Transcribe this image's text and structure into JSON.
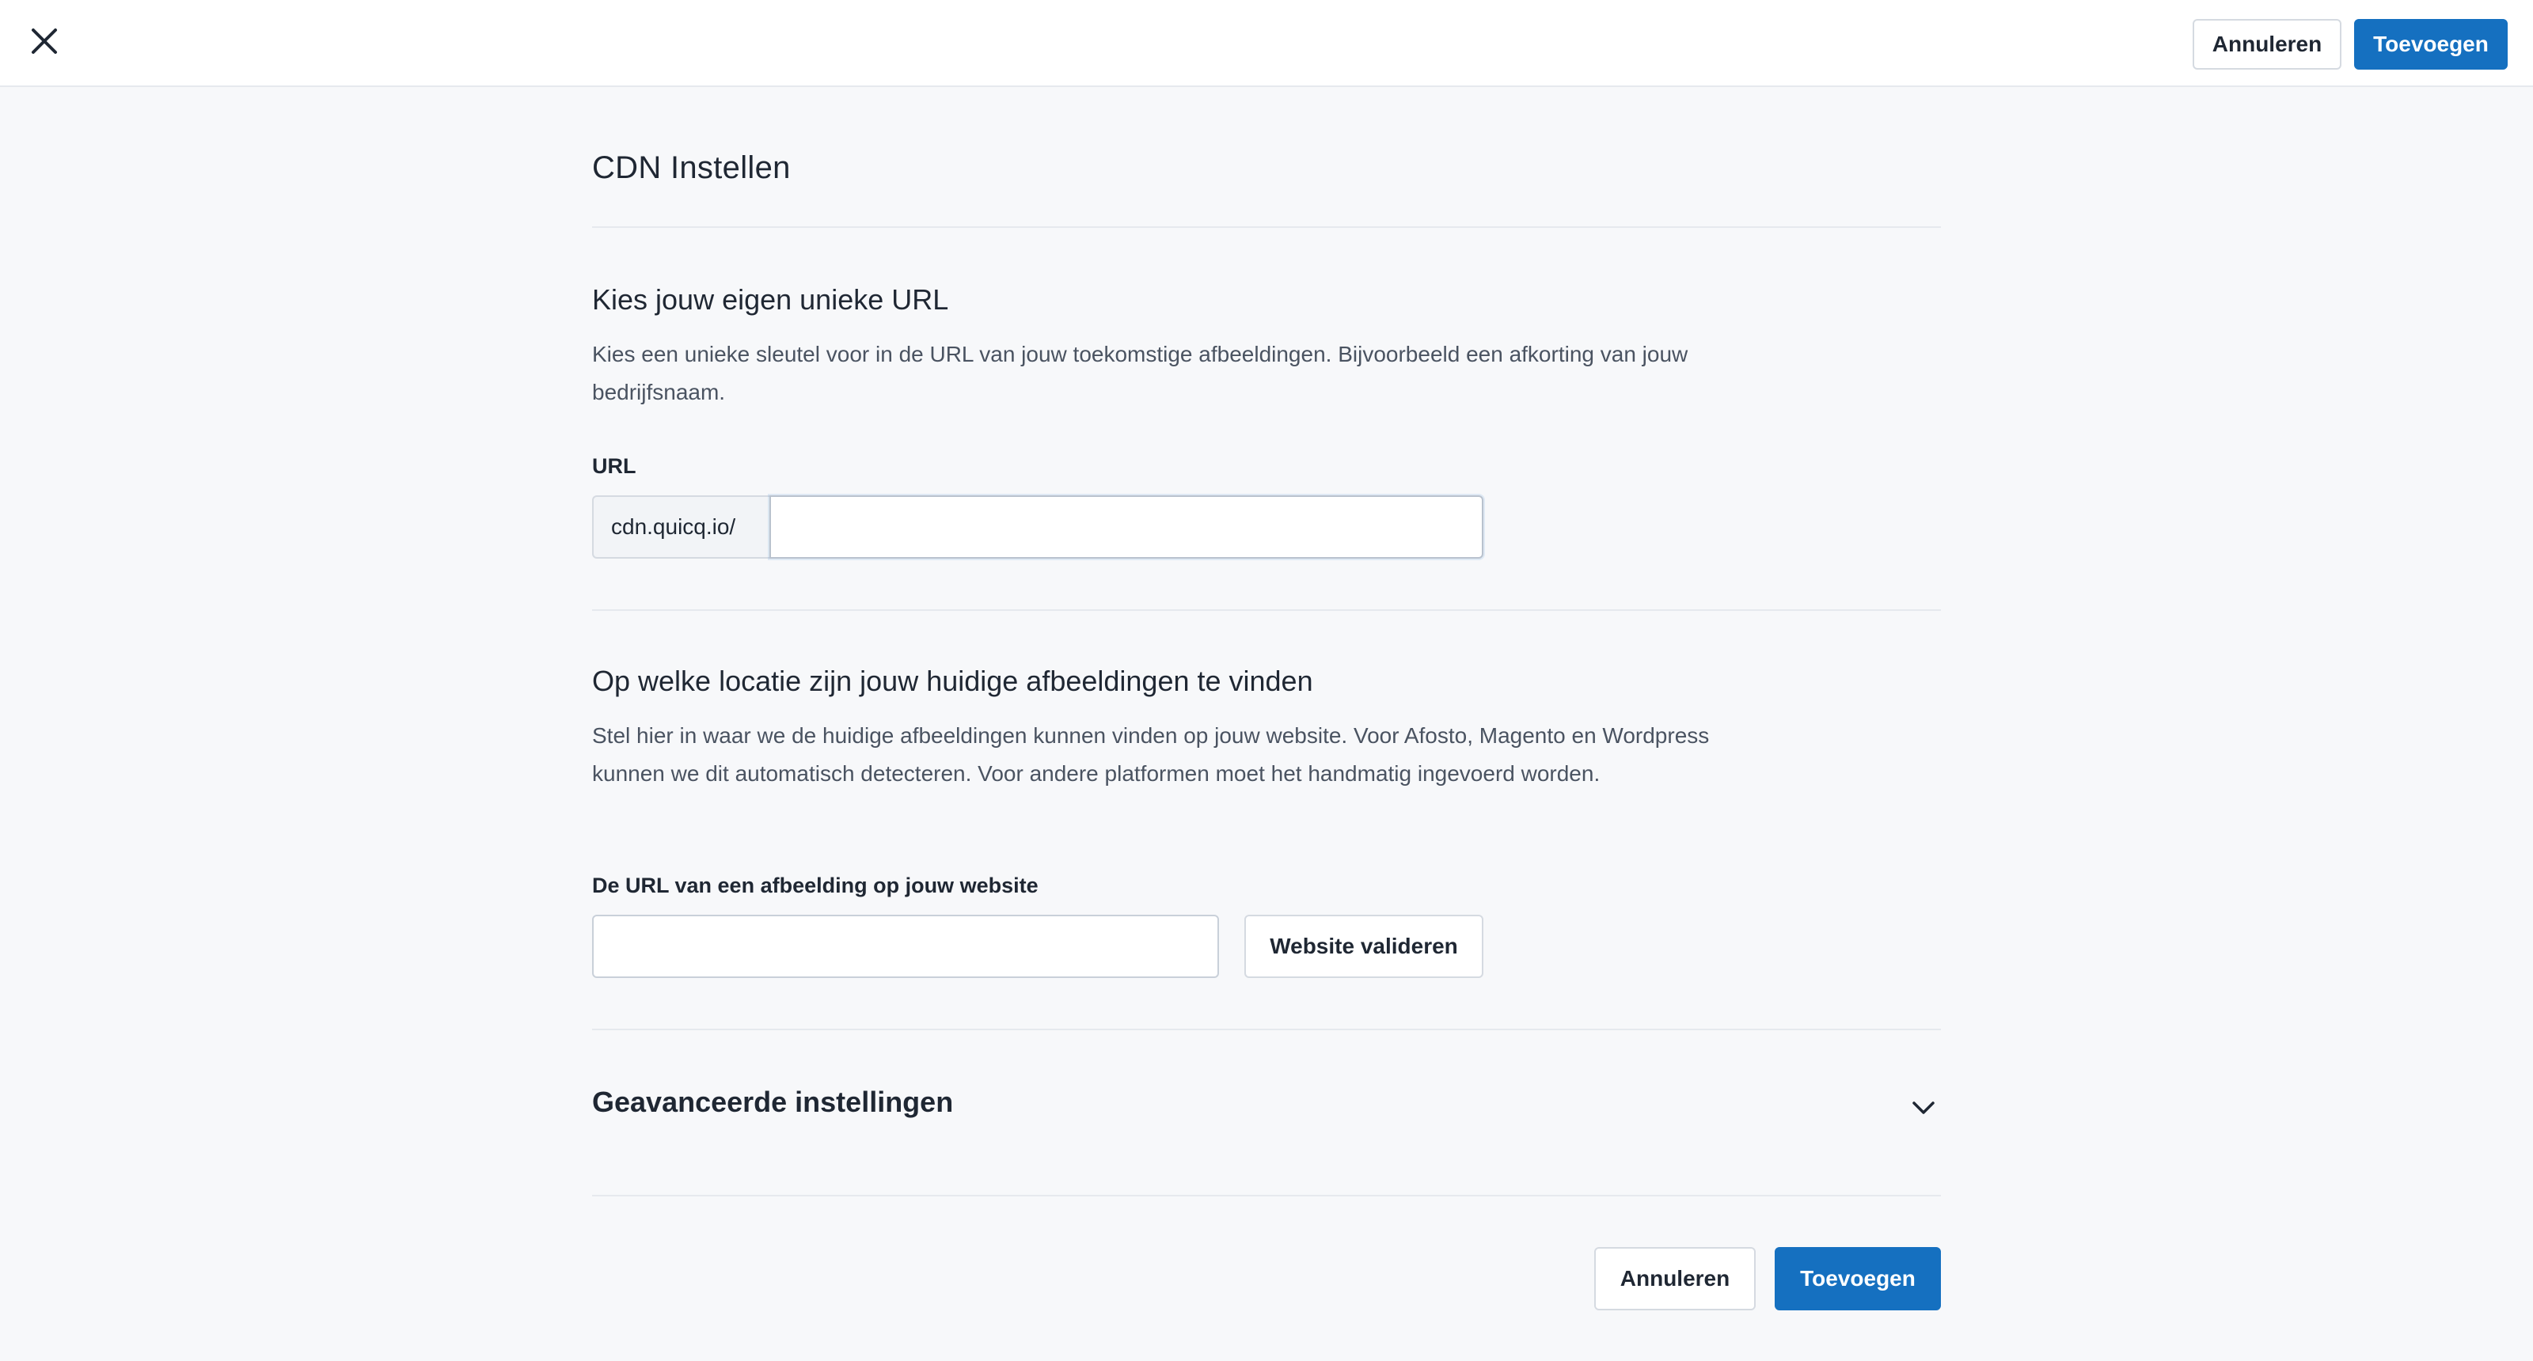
{
  "topbar": {
    "close_icon": "close-icon",
    "cancel_label": "Annuleren",
    "add_label": "Toevoegen"
  },
  "page": {
    "title": "CDN Instellen"
  },
  "url_section": {
    "title": "Kies jouw eigen unieke URL",
    "description": "Kies een unieke sleutel voor in de URL van jouw toekomstige afbeeldingen. Bijvoorbeeld een afkorting van jouw bedrijfsnaam.",
    "field_label": "URL",
    "prefix": "cdn.quicq.io/",
    "value": ""
  },
  "location_section": {
    "title": "Op welke locatie zijn jouw huidige afbeeldingen te vinden",
    "description": "Stel hier in waar we de huidige afbeeldingen kunnen vinden op jouw website. Voor Afosto, Magento en Wordpress kunnen we dit automatisch detecteren. Voor andere platformen moet het handmatig ingevoerd worden.",
    "field_label": "De URL van een afbeelding op jouw website",
    "value": "",
    "validate_label": "Website valideren"
  },
  "advanced": {
    "title": "Geavanceerde instellingen",
    "icon": "chevron-down-icon"
  },
  "footer": {
    "cancel_label": "Annuleren",
    "add_label": "Toevoegen"
  },
  "colors": {
    "primary": "#1570c0",
    "background": "#f7f8fa",
    "text": "#1f2733",
    "muted_text": "#4a5361",
    "border": "#d5dae1"
  }
}
